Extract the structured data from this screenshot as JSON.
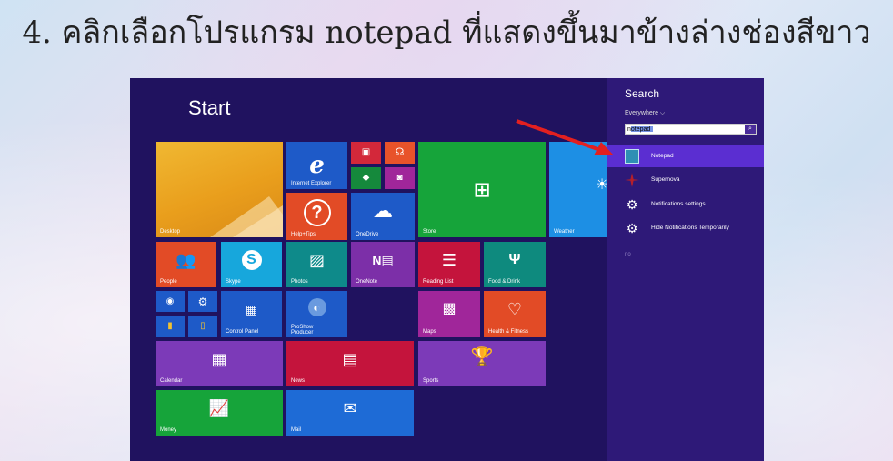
{
  "caption": "4. คลิกเลือกโปรแกรม notepad ที่แสดงขึ้นมาข้างล่างช่องสีขาว",
  "start": {
    "title": "Start"
  },
  "tiles": {
    "desktop": "Desktop",
    "ie": "Internet Explorer",
    "help": "Help+Tips",
    "onedrive": "OneDrive",
    "store": "Store",
    "weather": "Weather",
    "people": "People",
    "skype": "Skype",
    "photos": "Photos",
    "onenote": "OneNote",
    "reading": "Reading List",
    "food": "Food & Drink",
    "control": "Control Panel",
    "proshow": "ProShow\nProducer",
    "maps": "Maps",
    "health": "Health & Fitness",
    "calendar": "Calendar",
    "news": "News",
    "sports": "Sports",
    "money": "Money",
    "mail": "Mail"
  },
  "search": {
    "title": "Search",
    "scope": "Everywhere  ⌵",
    "query": "notepad",
    "results": [
      "Notepad",
      "Supernova",
      "Notifications settings",
      "Hide Notifications Temporarily"
    ]
  },
  "colors": {
    "start_bg": "#20125f",
    "search_bg": "#2e1978",
    "selected": "#5b2ed1",
    "arrow": "#e32020"
  }
}
